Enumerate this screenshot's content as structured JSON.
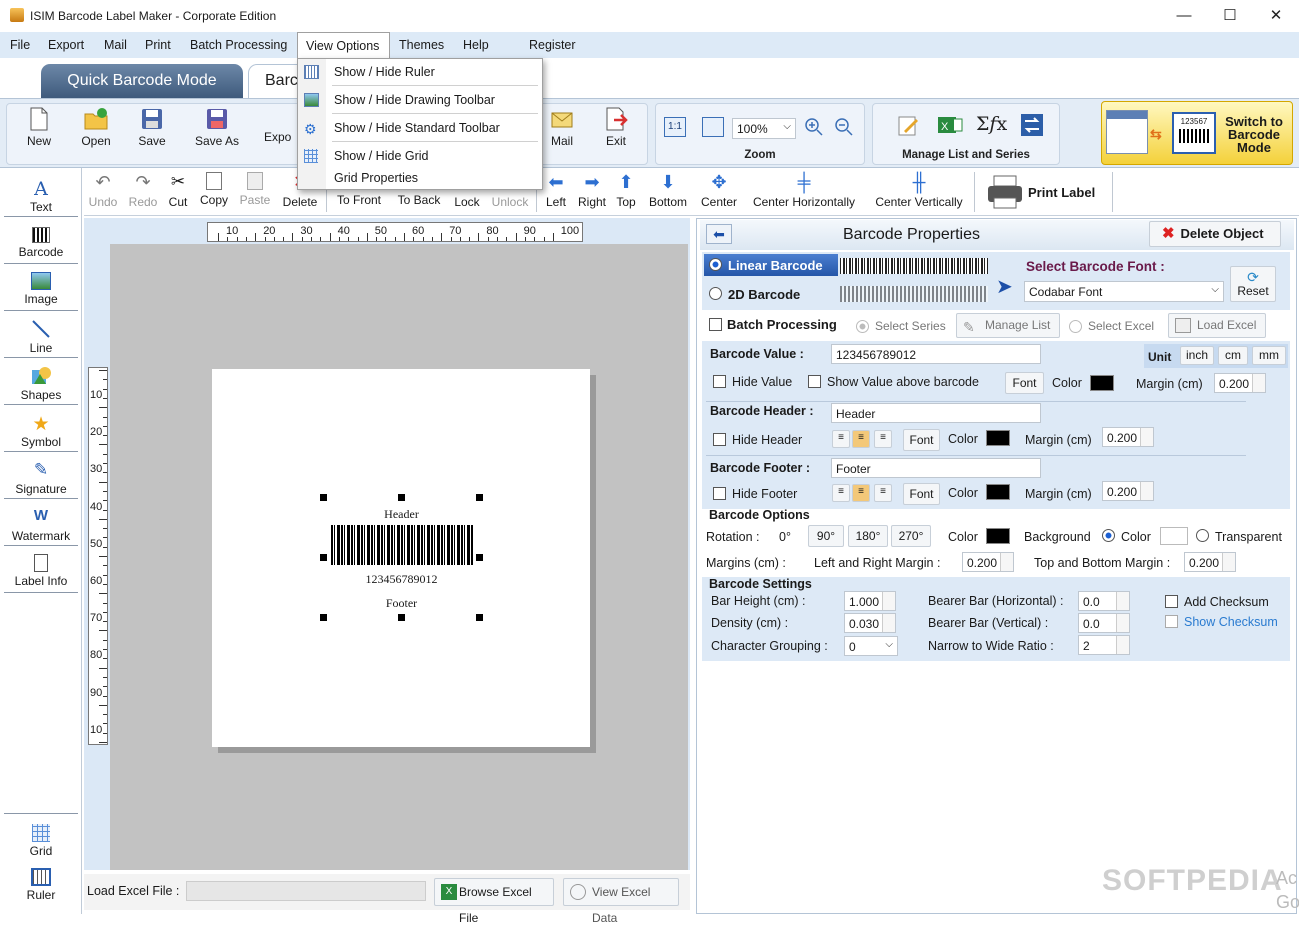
{
  "window": {
    "title": "ISIM Barcode Label Maker - Corporate Edition",
    "min": "—",
    "max": "☐",
    "close": "✕"
  },
  "menu": {
    "file": "File",
    "export": "Export",
    "mail": "Mail",
    "print": "Print",
    "batch": "Batch Processing",
    "view": "View Options",
    "themes": "Themes",
    "help": "Help",
    "register": "Register",
    "register_symbol": "$"
  },
  "view_menu": {
    "ruler": "Show / Hide Ruler",
    "drawing": "Show / Hide Drawing Toolbar",
    "standard": "Show / Hide Standard Toolbar",
    "grid": "Show / Hide Grid",
    "grid_props": "Grid Properties"
  },
  "modes": {
    "quick": "Quick Barcode Mode",
    "barcode_partial": "Barc"
  },
  "ribbon": {
    "new": "New",
    "open": "Open",
    "save": "Save",
    "save_as": "Save As",
    "export_partial": "Expo",
    "mail": "Mail",
    "exit": "Exit",
    "zoom_fit": "1:1",
    "zoom_value": "100%",
    "zoom_label": "Zoom",
    "manage_label": "Manage List and Series",
    "sigma": "Σ𝑓x",
    "switch": "Switch to Barcode Mode",
    "switch_code": "123567"
  },
  "edit_toolbar": {
    "undo": "Undo",
    "redo": "Redo",
    "cut": "Cut",
    "copy": "Copy",
    "paste": "Paste",
    "delete": "Delete",
    "to_front": "To Front",
    "to_back": "To Back",
    "lock": "Lock",
    "unlock": "Unlock",
    "left": "Left",
    "right": "Right",
    "top": "Top",
    "bottom": "Bottom",
    "center": "Center",
    "center_h": "Center Horizontally",
    "center_v": "Center Vertically",
    "print_label": "Print Label"
  },
  "sidebar": {
    "text": "Text",
    "barcode": "Barcode",
    "image": "Image",
    "line": "Line",
    "shapes": "Shapes",
    "symbol": "Symbol",
    "signature": "Signature",
    "watermark": "Watermark",
    "label_info": "Label Info",
    "grid": "Grid",
    "ruler": "Ruler"
  },
  "ruler": {
    "h": [
      "10",
      "20",
      "30",
      "40",
      "50",
      "60",
      "70",
      "80",
      "90",
      "100"
    ],
    "v": [
      "10",
      "20",
      "30",
      "40",
      "50",
      "60",
      "70",
      "80",
      "90",
      "10"
    ]
  },
  "label": {
    "header": "Header",
    "value": "123456789012",
    "footer": "Footer"
  },
  "load": {
    "label": "Load Excel File :",
    "browse": "Browse Excel File",
    "view": "View Excel Data"
  },
  "props": {
    "title": "Barcode Properties",
    "delete_object": "Delete Object",
    "linear": "Linear Barcode",
    "twod": "2D Barcode",
    "select_font": "Select Barcode Font :",
    "font_value": "Codabar Font",
    "reset": "Reset",
    "batch": "Batch Processing",
    "select_series": "Select Series",
    "manage_list": "Manage List",
    "select_excel": "Select Excel",
    "load_excel": "Load Excel",
    "value_label": "Barcode Value :",
    "value": "123456789012",
    "unit": "Unit",
    "inch": "inch",
    "cm": "cm",
    "mm": "mm",
    "hide_value": "Hide Value",
    "show_above": "Show Value above barcode",
    "font": "Font",
    "color": "Color",
    "margin_cm": "Margin (cm)",
    "margin_value": "0.200",
    "header_label": "Barcode Header :",
    "header_value": "Header",
    "hide_header": "Hide Header",
    "footer_label": "Barcode Footer :",
    "footer_value": "Footer",
    "hide_footer": "Hide Footer",
    "options": "Barcode Options",
    "rotation": "Rotation :",
    "r0": "0°",
    "r90": "90°",
    "r180": "180°",
    "r270": "270°",
    "background": "Background",
    "bg_color": "Color",
    "transparent": "Transparent",
    "margins_cm": "Margins (cm) :",
    "lr_margin": "Left and Right Margin :",
    "tb_margin": "Top and Bottom Margin :",
    "settings": "Barcode Settings",
    "bar_height": "Bar Height (cm) :",
    "bar_height_v": "1.000",
    "density": "Density (cm) :",
    "density_v": "0.030",
    "char_group": "Character Grouping :",
    "char_group_v": "0",
    "bearer_h": "Bearer Bar (Horizontal) :",
    "bearer_h_v": "0.0",
    "bearer_v": "Bearer Bar (Vertical) :",
    "bearer_v_v": "0.0",
    "ratio": "Narrow to Wide Ratio :",
    "ratio_v": "2",
    "add_checksum": "Add Checksum",
    "show_checksum": "Show Checksum"
  },
  "watermark": "SOFTPEDIA",
  "watermark_suffix": "Ac\nGo"
}
